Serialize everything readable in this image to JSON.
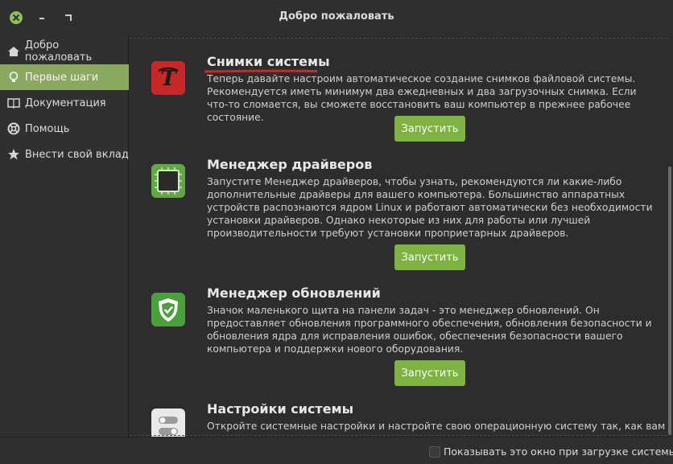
{
  "window": {
    "title": "Добро пожаловать"
  },
  "sidebar": {
    "items": [
      {
        "label": "Добро пожаловать",
        "icon": "home-icon"
      },
      {
        "label": "Первые шаги",
        "icon": "lightbulb-icon"
      },
      {
        "label": "Документация",
        "icon": "book-icon"
      },
      {
        "label": "Помощь",
        "icon": "lifebuoy-icon"
      },
      {
        "label": "Внести свой вклад",
        "icon": "star-icon"
      }
    ],
    "active_index": 1
  },
  "sections": [
    {
      "title": "Снимки системы",
      "description": "Теперь давайте настроим автоматическое создание снимков файловой системы. Рекомендуется иметь минимум два ежедневных и два загрузочных снимка. Если что-то сломается, вы сможете восстановить ваш компьютер в прежнее рабочее состояние.",
      "button": "Запустить",
      "icon": "timeshift-icon"
    },
    {
      "title": "Менеджер драйверов",
      "description": "Запустите Менеджер драйверов, чтобы узнать, рекомендуются ли какие-либо дополнительные драйверы для вашего компьютера. Большинство аппаратных устройств распознаются ядром Linux и работают автоматически без необходимости установки драйверов. Однако некоторые из них для работы или лучшей производительности требуют установки проприетарных драйверов.",
      "button": "Запустить",
      "icon": "driver-chip-icon"
    },
    {
      "title": "Менеджер обновлений",
      "description": "Значок маленького щита на панели задач - это менеджер обновлений. Он предоставляет обновления программного обеспечения, обновления безопасности и обновления ядра для исправления ошибок, обеспечения безопасности вашего компьютера и поддержки нового оборудования.",
      "button": "Запустить",
      "icon": "shield-icon"
    },
    {
      "title": "Настройки системы",
      "description": "Откройте системные настройки и настройте свою операционную систему так, как вам",
      "icon": "settings-toggle-icon"
    }
  ],
  "footer": {
    "checkbox_label": "Показывать это окно при загрузке системы"
  },
  "colors": {
    "accent": "#8aa860",
    "button": "#7cb342",
    "annotation": "#e0201e"
  }
}
